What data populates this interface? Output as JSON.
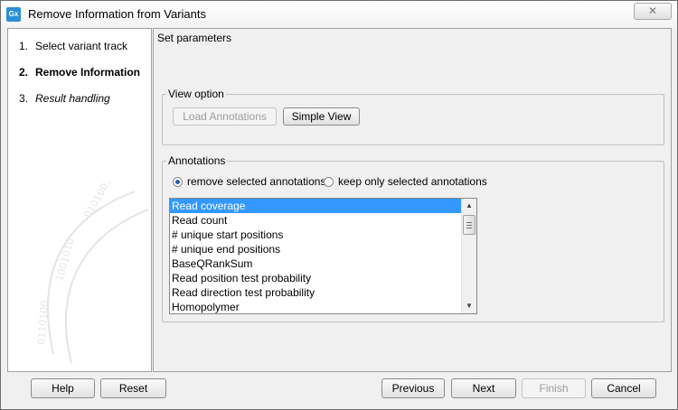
{
  "window": {
    "title": "Remove Information from Variants",
    "app_icon_label": "Gx",
    "close_label": "✕"
  },
  "steps": [
    {
      "num": "1.",
      "label": "Select variant track"
    },
    {
      "num": "2.",
      "label": "Remove Information"
    },
    {
      "num": "3.",
      "label": "Result handling"
    }
  ],
  "main": {
    "header": "Set parameters",
    "view_option": {
      "legend": "View option",
      "load_annotations": "Load Annotations",
      "simple_view": "Simple View"
    },
    "annotations": {
      "legend": "Annotations",
      "radio_remove": "remove selected annotations",
      "radio_keep": "keep only selected annotations",
      "selected_radio": "remove",
      "items": [
        "Read coverage",
        "Read count",
        "# unique start positions",
        "# unique end positions",
        "BaseQRankSum",
        "Read position test probability",
        "Read direction test probability",
        "Homopolymer"
      ],
      "selected_index": 0
    }
  },
  "footer": {
    "help": "Help",
    "reset": "Reset",
    "previous": "Previous",
    "next": "Next",
    "finish": "Finish",
    "cancel": "Cancel"
  },
  "icons": {
    "scroll_up": "scroll-up-arrow",
    "scroll_down": "scroll-down-arrow"
  }
}
